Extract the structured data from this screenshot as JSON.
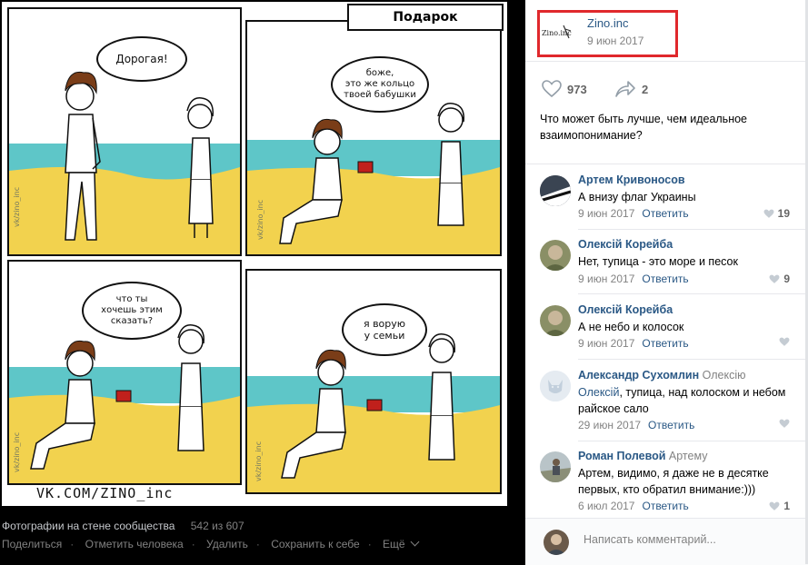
{
  "comic": {
    "title": "Подарок",
    "bubble1": "Дорогая!",
    "bubble2": "боже,\nэто же кольцо\nтвоей бабушки",
    "bubble3": "что ты\nхочешь этим\nсказать?",
    "bubble4": "я ворую\nу семьи",
    "watermark": "vk/zino_inc",
    "signature": "VK.COM/ZINO_inc"
  },
  "photo_meta": {
    "album": "Фотографии на стене сообщества",
    "counter": "542 из 607"
  },
  "actions": [
    "Поделиться",
    "Отметить человека",
    "Удалить",
    "Сохранить к себе",
    "Ещё"
  ],
  "post": {
    "logo_text": "Zino.inc",
    "author": "Zino.inc",
    "date": "9 июн 2017",
    "likes": "973",
    "shares": "2",
    "text": "Что может быть лучше, чем идеальное взаимопонимание?"
  },
  "comments": [
    {
      "name": "Артем Кривоносов",
      "reply_to": "",
      "mention": "",
      "text": "А внизу флаг Украины",
      "date": "9 июн 2017",
      "reply": "Ответить",
      "likes": "19"
    },
    {
      "name": "Олексій Корейба",
      "reply_to": "",
      "mention": "",
      "text": "Нет, тупица - это море и песок",
      "date": "9 июн 2017",
      "reply": "Ответить",
      "likes": "9"
    },
    {
      "name": "Олексій Корейба",
      "reply_to": "",
      "mention": "",
      "text": "А не небо и колосок",
      "date": "9 июн 2017",
      "reply": "Ответить",
      "likes": ""
    },
    {
      "name": "Александр Сухомлин",
      "reply_to": "Олексію",
      "mention": "Олексій",
      "text": ", тупица, над колоском и небом райское сало",
      "date": "29 июн 2017",
      "reply": "Ответить",
      "likes": ""
    },
    {
      "name": "Роман Полевой",
      "reply_to": "Артему",
      "mention": "",
      "text": "Артем, видимо, я даже не в десятке первых, кто обратил внимание:)))",
      "date": "6 июл 2017",
      "reply": "Ответить",
      "likes": "1"
    }
  ],
  "comment_input": {
    "placeholder": "Написать комментарий..."
  },
  "colors": {
    "link": "#2a5885",
    "muted": "#828282",
    "highlight_border": "#e0282c",
    "sea": "#5ec6c8",
    "sand": "#f2d24e"
  }
}
